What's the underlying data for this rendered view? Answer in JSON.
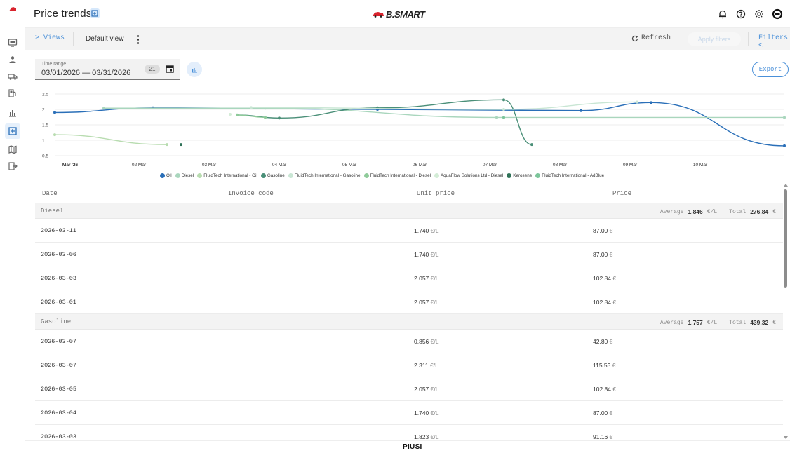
{
  "header": {
    "title": "Price trends",
    "brand": "B.SMART"
  },
  "toolbar": {
    "views_label": "> Views",
    "default_view_label": "Default view",
    "refresh_label": "Refresh",
    "apply_filters_label": "Apply filters",
    "filters_label": "Filters <"
  },
  "time_range": {
    "label": "Time range",
    "value": "03/01/2026 — 03/31/2026",
    "badge": "21"
  },
  "export_label": "Export",
  "colors": {
    "accent": "#4a90d9",
    "oil": "#1f5ea8",
    "diesel": "#7fbf9f",
    "fluidtech_oil": "#b9dcb0",
    "gasoline": "#3d8b6e",
    "fluidtech_gasoline": "#9fd3b0",
    "fluidtech_diesel": "#8fcf8f",
    "aquaflow_diesel": "#c6e8c9",
    "kerosene": "#2f7258",
    "fluidtech_adblue": "#7cc59a"
  },
  "chart_data": {
    "type": "line",
    "categories": [
      "Mar '26",
      "02 Mar",
      "03 Mar",
      "04 Mar",
      "05 Mar",
      "06 Mar",
      "07 Mar",
      "08 Mar",
      "09 Mar",
      "10 Mar"
    ],
    "yticks": [
      "2.5",
      "2",
      "1.5",
      "1",
      "0.5"
    ],
    "ylim": [
      0.5,
      2.5
    ],
    "xlim": [
      0,
      10.4
    ],
    "grid": true,
    "legend_position": "bottom",
    "series": [
      {
        "name": "Oil",
        "color": "#2a6fb8",
        "points": [
          [
            0.0,
            1.9
          ],
          [
            1.4,
            2.05
          ],
          [
            4.6,
            2.0
          ],
          [
            7.5,
            1.96
          ],
          [
            8.5,
            2.22
          ],
          [
            10.4,
            0.82
          ]
        ]
      },
      {
        "name": "Diesel",
        "color": "#a9d6bd",
        "points": [
          [
            0.7,
            2.04
          ],
          [
            3.0,
            2.04
          ],
          [
            6.3,
            1.74
          ],
          [
            10.4,
            1.74
          ]
        ]
      },
      {
        "name": "FluidTech International - Oil",
        "color": "#b8dcb0",
        "points": [
          [
            0.0,
            1.18
          ],
          [
            1.6,
            0.86
          ]
        ]
      },
      {
        "name": "Gasoline",
        "color": "#4a8f78",
        "points": [
          [
            2.6,
            1.82
          ],
          [
            3.2,
            1.72
          ],
          [
            4.6,
            2.05
          ],
          [
            6.4,
            2.31
          ],
          [
            6.8,
            0.86
          ]
        ]
      },
      {
        "name": "FluidTech International - Gasoline",
        "color": "#c9e6d4",
        "points": [
          [
            2.8,
            2.06
          ],
          [
            6.4,
            2.0
          ],
          [
            8.3,
            2.24
          ]
        ]
      },
      {
        "name": "FluidTech International - Diesel",
        "color": "#8fcb9a",
        "points": [
          [
            2.6,
            1.82
          ],
          [
            3.0,
            1.74
          ]
        ]
      },
      {
        "name": "AquaFlow Solutions Ltd - Diesel",
        "color": "#d3ecd6",
        "points": [
          [
            2.5,
            1.84
          ]
        ]
      },
      {
        "name": "Kerosene",
        "color": "#2f7258",
        "points": [
          [
            1.8,
            0.86
          ]
        ]
      },
      {
        "name": "FluidTech International - AdBlue",
        "color": "#7cc59a",
        "points": [
          [
            6.4,
            1.74
          ]
        ]
      }
    ]
  },
  "table": {
    "columns": [
      "Date",
      "Invoice code",
      "Unit price",
      "Price"
    ],
    "groups": [
      {
        "name": "Diesel",
        "average_label": "Average",
        "average_value": "1.846",
        "average_unit": "€/L",
        "total_label": "Total",
        "total_value": "276.84",
        "total_unit": "€",
        "rows": [
          {
            "date": "2026-03-11",
            "unit_price": "1.740",
            "unit": "€/L",
            "price": "87.00",
            "price_unit": "€"
          },
          {
            "date": "2026-03-06",
            "unit_price": "1.740",
            "unit": "€/L",
            "price": "87.00",
            "price_unit": "€"
          },
          {
            "date": "2026-03-03",
            "unit_price": "2.057",
            "unit": "€/L",
            "price": "102.84",
            "price_unit": "€"
          },
          {
            "date": "2026-03-01",
            "unit_price": "2.057",
            "unit": "€/L",
            "price": "102.84",
            "price_unit": "€"
          }
        ]
      },
      {
        "name": "Gasoline",
        "average_label": "Average",
        "average_value": "1.757",
        "average_unit": "€/L",
        "total_label": "Total",
        "total_value": "439.32",
        "total_unit": "€",
        "rows": [
          {
            "date": "2026-03-07",
            "unit_price": "0.856",
            "unit": "€/L",
            "price": "42.80",
            "price_unit": "€"
          },
          {
            "date": "2026-03-07",
            "unit_price": "2.311",
            "unit": "€/L",
            "price": "115.53",
            "price_unit": "€"
          },
          {
            "date": "2026-03-05",
            "unit_price": "2.057",
            "unit": "€/L",
            "price": "102.84",
            "price_unit": "€"
          },
          {
            "date": "2026-03-04",
            "unit_price": "1.740",
            "unit": "€/L",
            "price": "87.00",
            "price_unit": "€"
          },
          {
            "date": "2026-03-03",
            "unit_price": "1.823",
            "unit": "€/L",
            "price": "91.16",
            "price_unit": "€"
          }
        ]
      }
    ]
  },
  "footer": {
    "logo": "PIUSI"
  }
}
